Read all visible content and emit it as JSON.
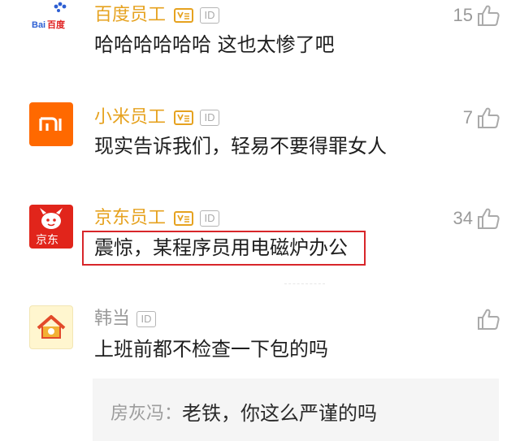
{
  "comments": [
    {
      "avatar": "baidu-logo",
      "avatar_text": "Bai百度",
      "username": "百度员工",
      "verified": true,
      "id_badge": "ID",
      "text": "哈哈哈哈哈哈 这也太惨了吧",
      "likes": "15"
    },
    {
      "avatar": "xiaomi-logo",
      "avatar_text": "MI",
      "username": "小米员工",
      "verified": true,
      "id_badge": "ID",
      "text": "现实告诉我们，轻易不要得罪女人",
      "likes": "7"
    },
    {
      "avatar": "jd-logo",
      "avatar_text": "京东",
      "username": "京东员工",
      "verified": true,
      "id_badge": "ID",
      "text": "震惊，某程序员用电磁炉办公",
      "likes": "34"
    },
    {
      "avatar": "house-avatar",
      "username": "韩当",
      "verified": false,
      "id_badge": "ID",
      "text": "上班前都不检查一下包的吗",
      "likes": "",
      "reply": {
        "author": "房灰冯：",
        "text": "老铁，你这么严谨的吗"
      }
    }
  ],
  "colors": {
    "verified_name": "#e6a21f",
    "highlight_box": "#d8262a",
    "xiaomi": "#ff6900",
    "jd": "#e1251b"
  }
}
